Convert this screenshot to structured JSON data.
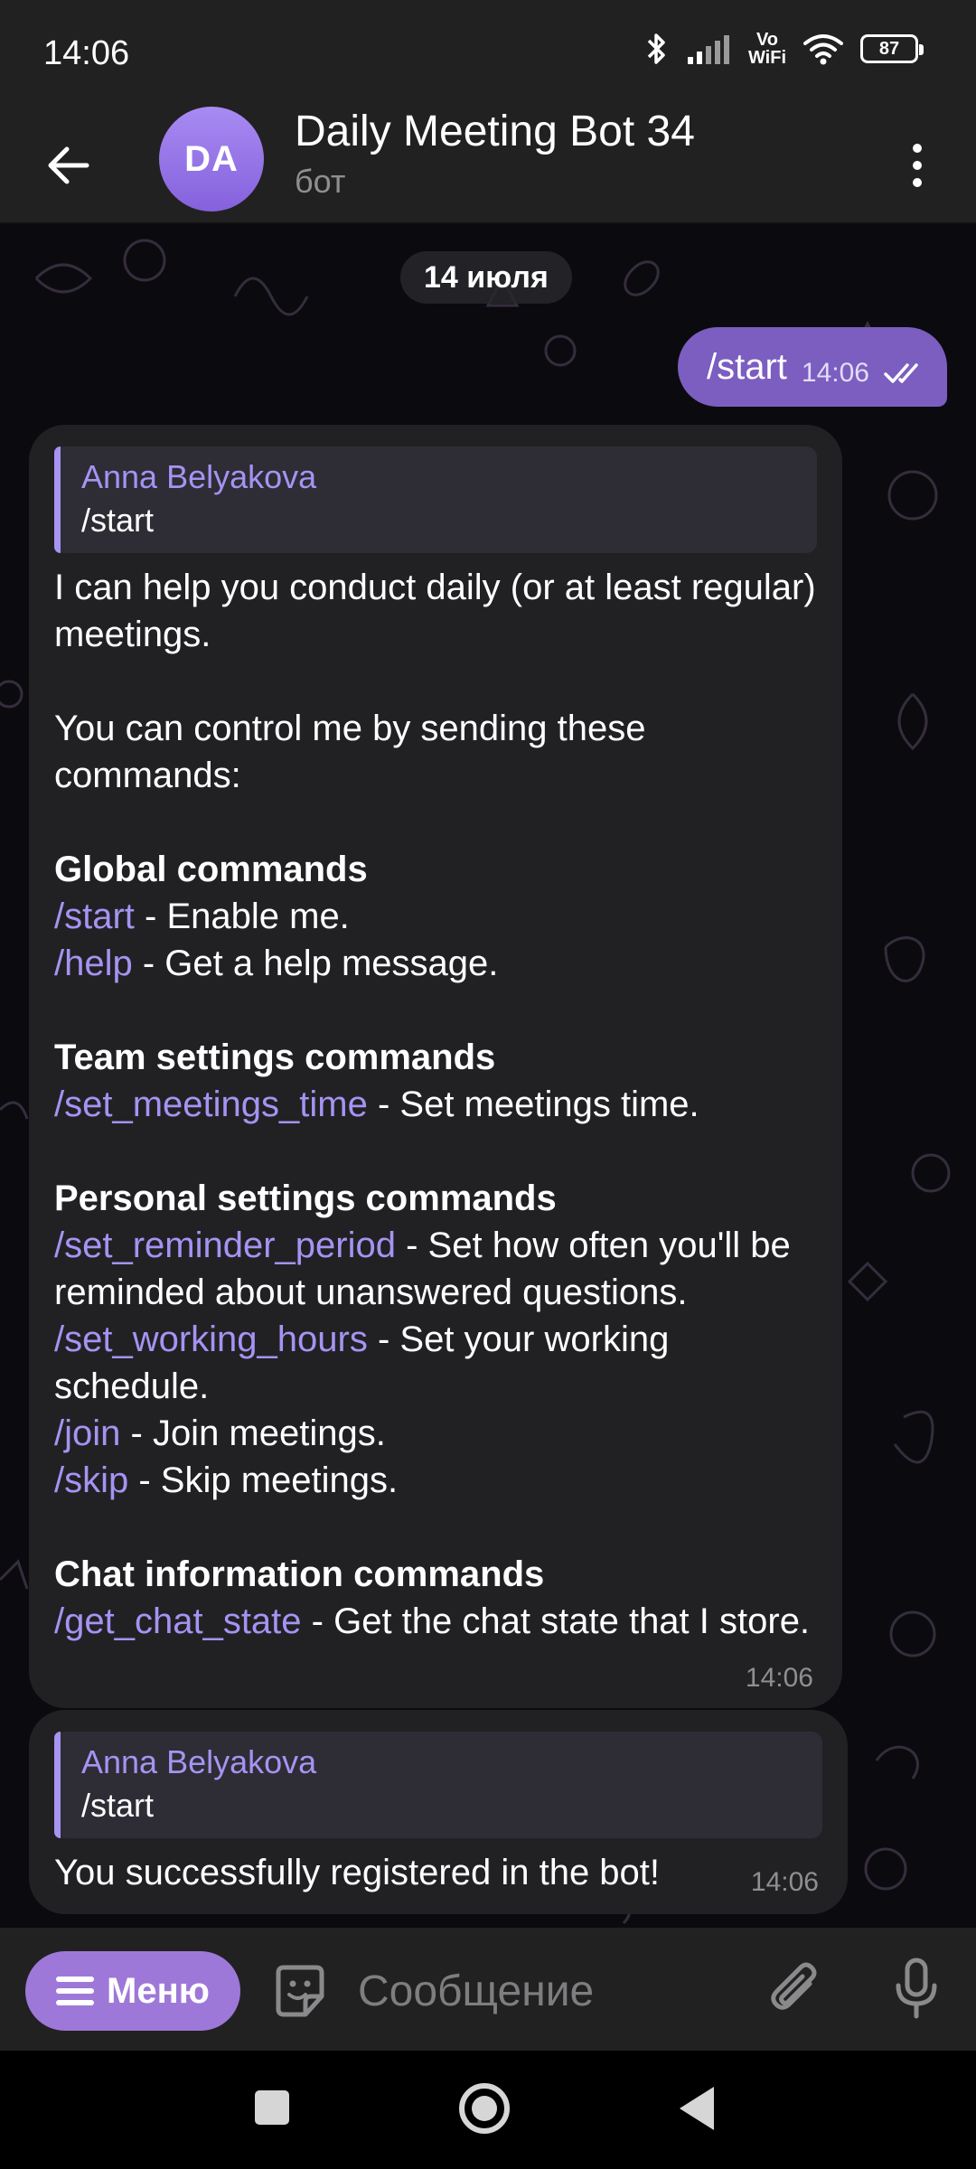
{
  "status_bar": {
    "time": "14:06",
    "battery": "87",
    "volte_top": "Vo",
    "volte_bottom": "WiFi",
    "icons": [
      "bluetooth-icon",
      "signal-icon",
      "vowifi-icon",
      "wifi-icon",
      "battery-icon"
    ]
  },
  "header": {
    "avatar_initials": "DA",
    "avatar_color": "#9673e6",
    "title": "Daily Meeting Bot 34",
    "subtitle": "бот"
  },
  "chat": {
    "date_separator": "14 июля",
    "outgoing": {
      "text": "/start",
      "time": "14:06",
      "status": "read"
    },
    "messages": [
      {
        "reply_author": "Anna Belyakova",
        "reply_text": "/start",
        "time": "14:06",
        "intro_1": "I can help you conduct daily (or at least regular) meetings.",
        "intro_2": "You can control me by sending these commands:",
        "sections": [
          {
            "heading": "Global commands",
            "commands": [
              {
                "cmd": "/start",
                "desc": " - Enable me."
              },
              {
                "cmd": "/help",
                "desc": " - Get a help message."
              }
            ]
          },
          {
            "heading": "Team settings commands",
            "commands": [
              {
                "cmd": "/set_meetings_time",
                "desc": " - Set meetings time."
              }
            ]
          },
          {
            "heading": "Personal settings commands",
            "commands": [
              {
                "cmd": "/set_reminder_period",
                "desc": " - Set how often you'll be reminded about unanswered questions."
              },
              {
                "cmd": "/set_working_hours",
                "desc": " - Set your working schedule."
              },
              {
                "cmd": "/join",
                "desc": " - Join meetings."
              },
              {
                "cmd": "/skip",
                "desc": " - Skip meetings."
              }
            ]
          },
          {
            "heading": "Chat information commands",
            "commands": [
              {
                "cmd": "/get_chat_state",
                "desc": " - Get the chat state that I store."
              }
            ]
          }
        ]
      },
      {
        "reply_author": "Anna Belyakova",
        "reply_text": "/start",
        "text": "You successfully registered in the bot!",
        "time": "14:06"
      }
    ]
  },
  "input_bar": {
    "menu_label": "Меню",
    "placeholder": "Сообщение"
  },
  "colors": {
    "accent": "#a693f2",
    "outgoing_bubble": "#7b5ec0",
    "incoming_bubble": "#212124",
    "menu_button": "#9e78d8"
  }
}
